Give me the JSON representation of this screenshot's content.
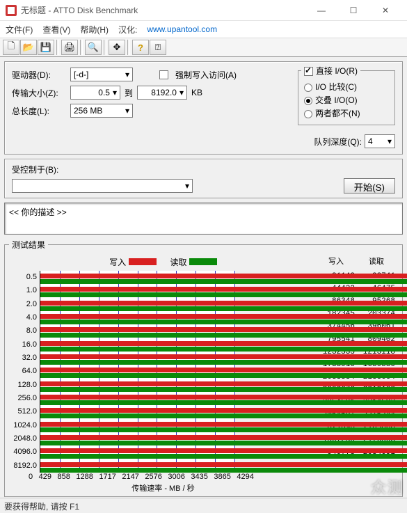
{
  "window": {
    "title": "无标题 - ATTO Disk Benchmark",
    "min": "—",
    "max": "☐",
    "close": "✕"
  },
  "menu": {
    "file": "文件(F)",
    "view": "查看(V)",
    "help": "帮助(H)",
    "locale_label": "汉化:",
    "locale_link": "www.upantool.com"
  },
  "toolbar": {
    "new": "🗋",
    "open": "📂",
    "save": "💾",
    "print": "🖨",
    "find": "🔍",
    "move": "✥",
    "help": "?",
    "whatsthis": "⍰"
  },
  "settings": {
    "drive_label": "驱动器(D):",
    "drive_value": "[-d-]",
    "xfer_label": "传输大小(Z):",
    "xfer_from": "0.5",
    "xfer_to_label": "到",
    "xfer_to": "8192.0",
    "xfer_unit": "KB",
    "len_label": "总长度(L):",
    "len_value": "256 MB",
    "force_write": "强制写入访问(A)",
    "direct_io": "直接 I/O(R)",
    "io_compare": "I/O 比较(C)",
    "io_overlap": "交叠 I/O(O)",
    "io_neither": "两者都不(N)",
    "queue_depth_label": "队列深度(Q):",
    "queue_depth_value": "4",
    "controlled_label": "受控制于(B):",
    "controlled_value": "",
    "start": "开始(S)",
    "description": "<<  你的描述  >>"
  },
  "results_title": "测试结果",
  "legend_write": "写入",
  "legend_read": "读取",
  "col_write": "写入",
  "col_read": "读取",
  "x_title": "传输速率 - MB / 秒",
  "x_ticks": [
    "0",
    "429",
    "858",
    "1288",
    "1717",
    "2147",
    "2576",
    "3006",
    "3435",
    "3865",
    "4294"
  ],
  "chart_data": {
    "type": "bar",
    "xlabel": "传输速率 - MB / 秒",
    "ylabel": "",
    "xlim": [
      0,
      4294
    ],
    "categories": [
      "0.5",
      "1.0",
      "2.0",
      "4.0",
      "8.0",
      "16.0",
      "32.0",
      "64.0",
      "128.0",
      "256.0",
      "512.0",
      "1024.0",
      "2048.0",
      "4096.0",
      "8192.0"
    ],
    "series": [
      {
        "name": "写入",
        "color": "#d82020",
        "values": [
          21142,
          44432,
          86348,
          182345,
          374456,
          795541,
          1232535,
          1738910,
          2035854,
          2006676,
          2054691,
          2054691,
          821096,
          1567250,
          940778
        ]
      },
      {
        "name": "读取",
        "color": "#0a8a0a",
        "values": [
          22741,
          46475,
          95268,
          203374,
          396061,
          809402,
          1213118,
          1689880,
          2158664,
          2219103,
          2214592,
          2215244,
          2165860,
          2176503,
          2054691
        ]
      }
    ]
  },
  "status": "要获得帮助, 请按 F1",
  "watermark": "众测"
}
